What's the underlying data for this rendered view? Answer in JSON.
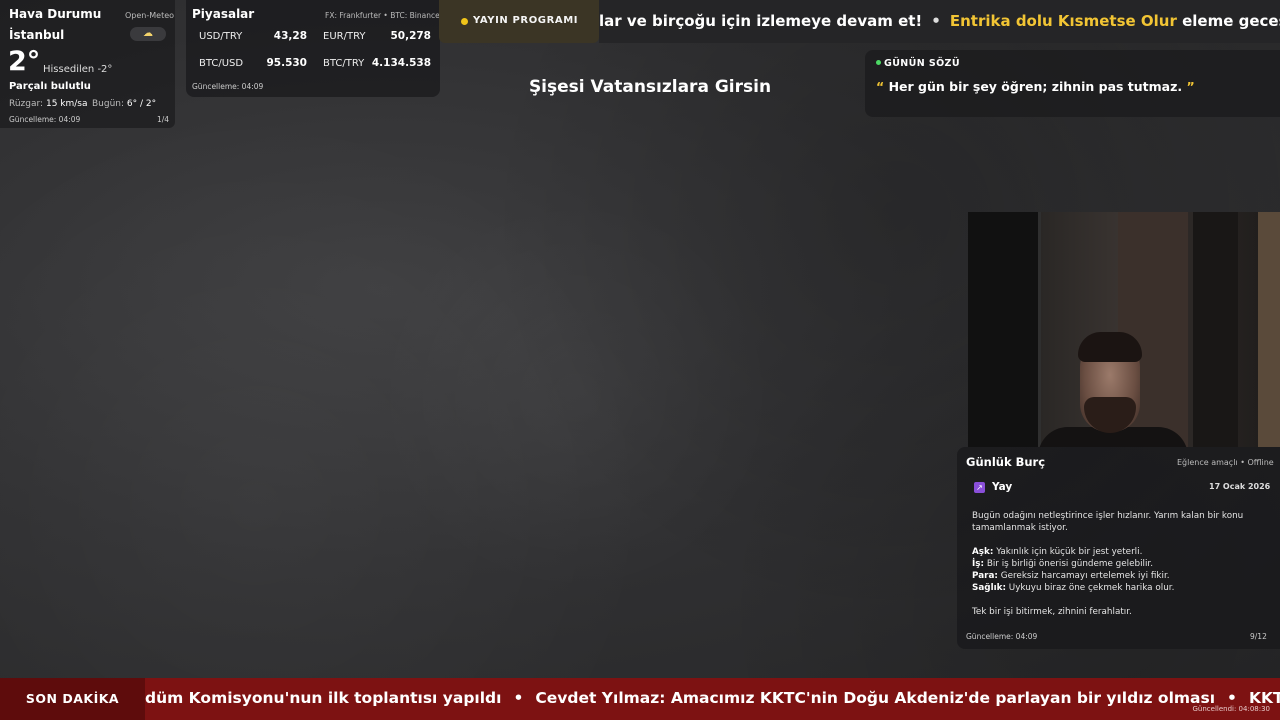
{
  "weather": {
    "title": "Hava Durumu",
    "source": "Open-Meteo",
    "city": "İstanbul",
    "temperature": "2°",
    "feels_like": "Hissedilen -2°",
    "condition": "Parçalı bulutlu",
    "wind_label": "Rüzgar:",
    "wind_value": "15 km/sa",
    "today_label": "Bugün:",
    "today_value": "6° / 2°",
    "updated": "Güncelleme: 04:09",
    "page": "1/4",
    "icon": "partly-cloudy-icon"
  },
  "markets": {
    "title": "Piyasalar",
    "source": "FX: Frankfurter • BTC: Binance",
    "rates": [
      {
        "label": "USD/TRY",
        "value": "43,28"
      },
      {
        "label": "EUR/TRY",
        "value": "50,278"
      },
      {
        "label": "BTC/USD",
        "value": "95.530"
      },
      {
        "label": "BTC/TRY",
        "value": "4.134.538"
      }
    ],
    "updated": "Güncelleme: 04:09"
  },
  "schedule": {
    "label": "YAYIN PROGRAMI",
    "ticker_part1": "lar ve birçoğu için izlemeye devam et!",
    "ticker_sep": "•",
    "ticker_highlight": "Entrika dolu Kısmetse Olur",
    "ticker_part2": "eleme gecesi ve iliş"
  },
  "center_title": "Şişesi Vatansızlara Girsin",
  "quote": {
    "label": "GÜNÜN SÖZÜ",
    "open_mark": "“",
    "text": "Her gün bir şey öğren; zihnin pas tutmaz.",
    "close_mark": "”"
  },
  "horoscope": {
    "title": "Günlük Burç",
    "source": "Eğlence amaçlı • Offline",
    "sign": "Yay",
    "sign_icon": "sagittarius-icon",
    "date": "17 Ocak 2026",
    "intro": "Bugün odağını netleştirince işler hızlanır. Yarım kalan bir konu tamamlanmak istiyor.",
    "love_label": "Aşk:",
    "love": "Yakınlık için küçük bir jest yeterli.",
    "work_label": "İş:",
    "work": "Bir iş birliği önerisi gündeme gelebilir.",
    "money_label": "Para:",
    "money": "Gereksiz harcamayı ertelemek iyi fikir.",
    "health_label": "Sağlık:",
    "health": "Uykuyu biraz öne çekmek harika olur.",
    "closing": "Tek bir işi bitirmek, zihnini ferahlatır.",
    "updated": "Güncelleme: 04:09",
    "page": "9/12"
  },
  "breaking": {
    "label": "SON DAKİKA",
    "item1": "düm Komisyonu'nun ilk toplantısı yapıldı",
    "sep": "•",
    "item2": "Cevdet Yılmaz: Amacımız KKTC'nin Doğu Akdeniz'de parlayan bir yıldız olması",
    "item3": "KKTC",
    "updated": "Güncellendi: 04:08:30"
  },
  "colors": {
    "accent_yellow": "#f2c534",
    "breaking_red": "#7d1212",
    "quote_dot_green": "#4cd964",
    "sign_purple": "#8a4fd9"
  }
}
